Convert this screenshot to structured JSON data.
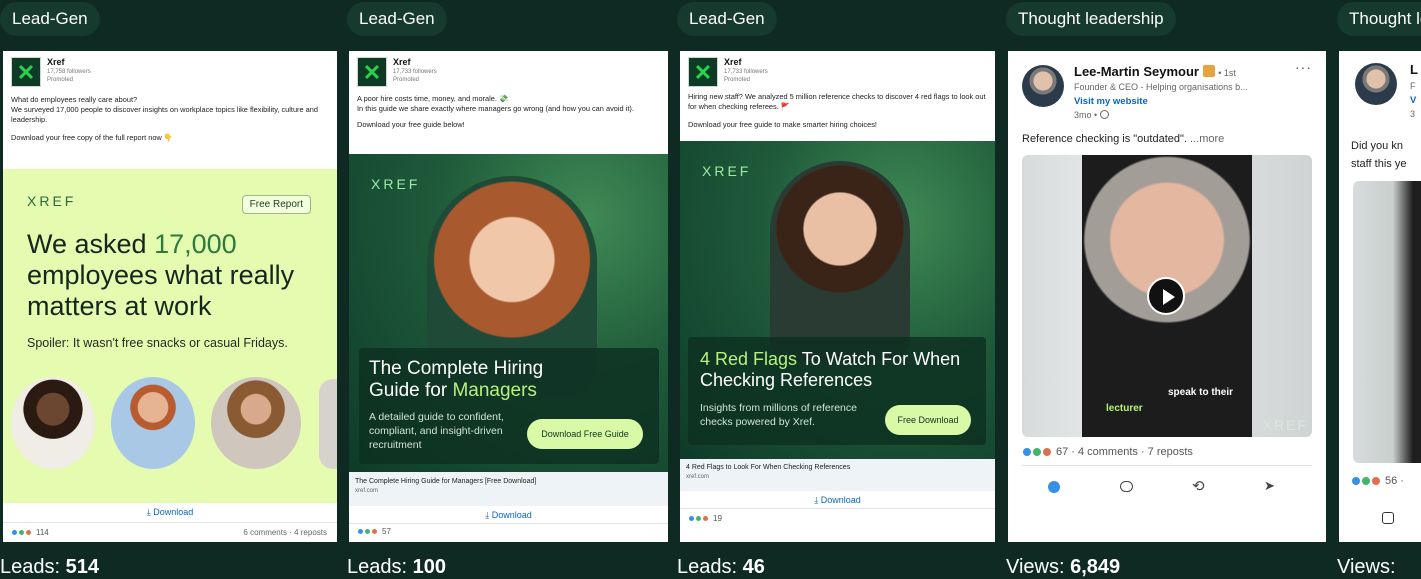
{
  "columns": [
    {
      "tag": "Lead-Gen",
      "metric_label": "Leads: ",
      "metric_value": "514",
      "company": "Xref",
      "followers": "17,758 followers",
      "promoted": "Promoted",
      "post_text_1": "What do employees really care about?",
      "post_text_2": "We surveyed 17,000 people to discover insights on workplace topics like flexibility, culture and leadership.",
      "post_text_3": "Download your free copy of the full report now 👇",
      "brand": "XREF",
      "badge": "Free Report",
      "headline_1": "We asked ",
      "headline_num": "17,000",
      "headline_2": "employees what really matters at work",
      "spoiler": "Spoiler: It wasn't free snacks or casual Fridays.",
      "download": "⤓ Download",
      "reaction_count": "114",
      "engagement": "6 comments · 4 reposts"
    },
    {
      "tag": "Lead-Gen",
      "metric_label": "Leads: ",
      "metric_value": "100",
      "company": "Xref",
      "followers": "17,733 followers",
      "promoted": "Promoted",
      "post_text_1": "A poor hire costs time, money, and morale. 💸",
      "post_text_2": "In this guide we share exactly where managers go wrong (and how you can avoid it).",
      "post_text_3": "Download your free guide below!",
      "brand": "XREF",
      "headline_1": "The Complete Hiring Guide for ",
      "headline_hl": "Managers",
      "subtext": "A detailed guide to confident, compliant, and insight-driven recruitment",
      "cta": "Download Free Guide",
      "link_title": "The Complete Hiring Guide for Managers [Free Download]",
      "link_domain": "xref.com",
      "download": "⤓ Download",
      "reaction_count": "57"
    },
    {
      "tag": "Lead-Gen",
      "metric_label": "Leads: ",
      "metric_value": "46",
      "company": "Xref",
      "followers": "17,733 followers",
      "promoted": "Promoted",
      "post_text_1": "Hiring new staff? We analyzed 5 million reference checks to discover 4 red flags to look out for when checking referees. 🚩",
      "post_text_3": "Download your free guide to make smarter hiring choices!",
      "brand": "XREF",
      "headline_hl": "4 Red Flags",
      "headline_1": " To Watch For When Checking References",
      "subtext": "Insights from millions of reference checks powered by Xref.",
      "cta": "Free Download",
      "link_title": "4 Red Flags to Look For When Checking References",
      "link_domain": "xref.com",
      "download": "⤓ Download",
      "reaction_count": "19"
    },
    {
      "tag": "Thought leadership",
      "metric_label": "Views: ",
      "metric_value": "6,849",
      "author": "Lee-Martin Seymour",
      "degree": "• 1st",
      "role": "Founder & CEO - Helping organisations b...",
      "website": "Visit my website",
      "time": "3mo •",
      "post_text": "Reference checking is \"outdated\".",
      "more": "...more",
      "caption_1": "speak to their",
      "caption_2": "lecturer",
      "watermark": "XREF",
      "reaction_count": "67",
      "engagement": "· 4 comments · 7 reposts"
    },
    {
      "tag": "Thought leadership",
      "metric_label": "Views: ",
      "metric_value": "",
      "author": "L",
      "role": "F",
      "website": "V",
      "time": "3",
      "post_text_1": "Did you kn",
      "post_text_2": "staff this ye",
      "reaction_count": "56 ·"
    }
  ],
  "colors": {
    "background": "#0f2a22",
    "tag_bg": "#173a2f",
    "lime": "#e4fbb0",
    "green_dark": "#0e3b29",
    "accent_green": "#b6f27a",
    "linkedin_blue": "#0a66c2"
  },
  "icons": [
    "x-logo-icon",
    "download-icon",
    "play-icon",
    "like-icon",
    "comment-icon",
    "repost-icon",
    "send-icon",
    "more-icon",
    "linkedin-badge-icon",
    "globe-icon"
  ]
}
